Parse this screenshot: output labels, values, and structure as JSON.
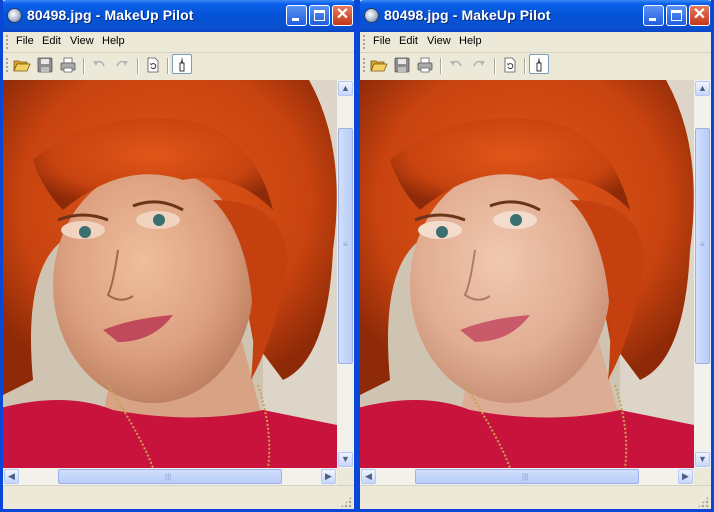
{
  "windows": [
    {
      "title": "80498.jpg - MakeUp Pilot",
      "image_description": "original",
      "menu": [
        "File",
        "Edit",
        "View",
        "Help"
      ],
      "toolbar": {
        "open_icon": "folder-open-icon",
        "save_icon": "floppy-save-icon",
        "print_icon": "printer-icon",
        "undo_icon": "undo-icon",
        "redo_icon": "redo-icon",
        "refresh_icon": "document-refresh-icon",
        "brush_icon": "brush-tool-icon"
      },
      "scroll": {
        "vertical_position": 0.55,
        "horizontal_position": 0.5
      },
      "status_text": ""
    },
    {
      "title": "80498.jpg - MakeUp Pilot",
      "image_description": "retouched",
      "menu": [
        "File",
        "Edit",
        "View",
        "Help"
      ],
      "toolbar": {
        "open_icon": "folder-open-icon",
        "save_icon": "floppy-save-icon",
        "print_icon": "printer-icon",
        "undo_icon": "undo-icon",
        "redo_icon": "redo-icon",
        "refresh_icon": "document-refresh-icon",
        "brush_icon": "brush-tool-icon"
      },
      "scroll": {
        "vertical_position": 0.55,
        "horizontal_position": 0.5
      },
      "status_text": ""
    }
  ],
  "colors": {
    "titlebar": "#0453d6",
    "window_face": "#ece9d8",
    "hair": "#d24a14",
    "skin": "#e8b090",
    "shirt": "#c8143c"
  }
}
